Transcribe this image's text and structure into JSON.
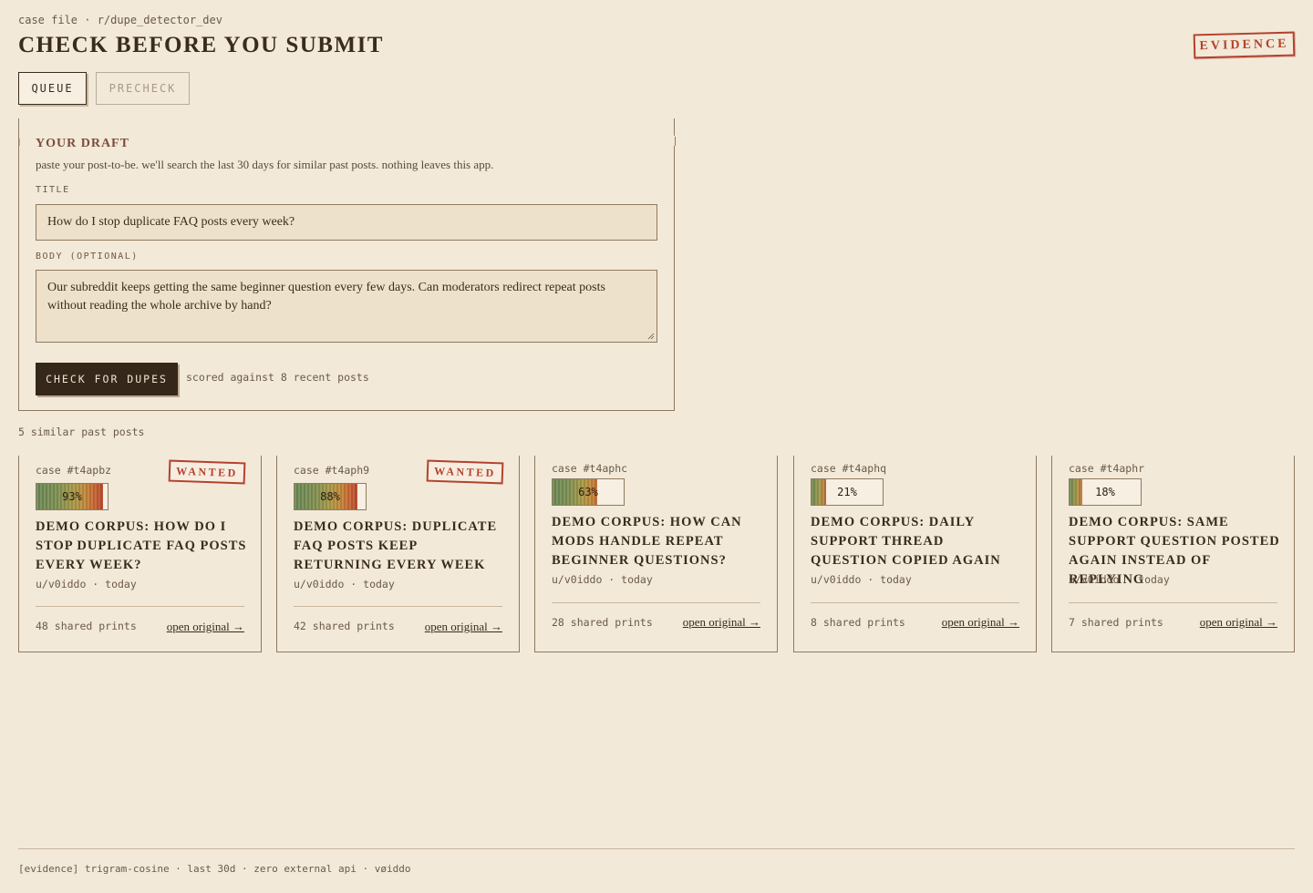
{
  "header": {
    "crumb": "case file · r/dupe_detector_dev",
    "title": "CHECK BEFORE YOU SUBMIT",
    "stamp": "EVIDENCE"
  },
  "tabs": [
    {
      "label": "QUEUE",
      "active": true
    },
    {
      "label": "PRECHECK",
      "active": false
    }
  ],
  "draft": {
    "heading": "YOUR DRAFT",
    "help": "paste your post-to-be. we'll search the last 30 days for similar past posts. nothing leaves this app.",
    "title_label": "TITLE",
    "title_value": "How do I stop duplicate FAQ posts every week?",
    "body_label": "BODY (OPTIONAL)",
    "body_value": "Our subreddit keeps getting the same beginner question every few days. Can moderators redirect repeat posts without reading the whole archive by hand?",
    "check_button": "CHECK FOR DUPES",
    "scored_note": "scored against 8 recent posts"
  },
  "results": {
    "count_label": "5 similar past posts",
    "cards": [
      {
        "case": "case #t4apbz",
        "wanted": "WANTED",
        "score": "93%",
        "score_value": 0.93,
        "title": "DEMO CORPUS: HOW DO I STOP DUPLICATE FAQ POSTS EVERY WEEK?",
        "byline": "u/v0iddo · today",
        "prints": "48 shared prints",
        "link": "open original →"
      },
      {
        "case": "case #t4aph9",
        "wanted": "WANTED",
        "score": "88%",
        "score_value": 0.88,
        "title": "DEMO CORPUS: DUPLICATE FAQ POSTS KEEP RETURNING EVERY WEEK",
        "byline": "u/v0iddo · today",
        "prints": "42 shared prints",
        "link": "open original →"
      },
      {
        "case": "case #t4aphc",
        "wanted": "",
        "score": "63%",
        "score_value": 0.63,
        "title": "DEMO CORPUS: HOW CAN MODS HANDLE REPEAT BEGINNER QUESTIONS?",
        "byline": "u/v0iddo · today",
        "prints": "28 shared prints",
        "link": "open original →"
      },
      {
        "case": "case #t4aphq",
        "wanted": "",
        "score": "21%",
        "score_value": 0.21,
        "title": "DEMO CORPUS: DAILY SUPPORT THREAD QUESTION COPIED AGAIN",
        "byline": "u/v0iddo · today",
        "prints": "8 shared prints",
        "link": "open original →"
      },
      {
        "case": "case #t4aphr",
        "wanted": "",
        "score": "18%",
        "score_value": 0.18,
        "title": "DEMO CORPUS: SAME SUPPORT QUESTION POSTED AGAIN INSTEAD OF REPLYING",
        "byline": "u/v0iddo · today",
        "prints": "7 shared prints",
        "link": "open original →"
      }
    ]
  },
  "footer": "[evidence] trigram-cosine · last 30d · zero external api · vøiddo",
  "colors": {
    "background": "#f2e9d9",
    "ink": "#3a2c1c",
    "stamp_red": "#b4412c",
    "button_dark": "#35281a"
  }
}
